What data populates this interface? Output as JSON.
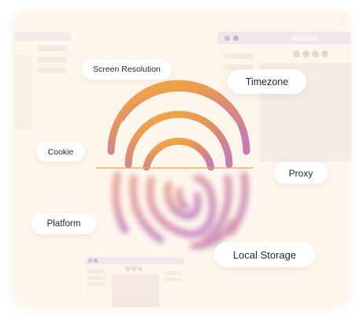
{
  "labels": {
    "screen_resolution": "Screen Resolution",
    "timezone": "Timezone",
    "cookie": "Cookie",
    "proxy": "Proxy",
    "platform": "Platform",
    "local_storage": "Local Storage"
  },
  "colors": {
    "background": "#fff7ee",
    "fingerprint_top": "#f7aa3c",
    "fingerprint_bottom": "#c47ab4",
    "divider": "#f3a53d"
  },
  "icons": {
    "center": "fingerprint-icon"
  }
}
